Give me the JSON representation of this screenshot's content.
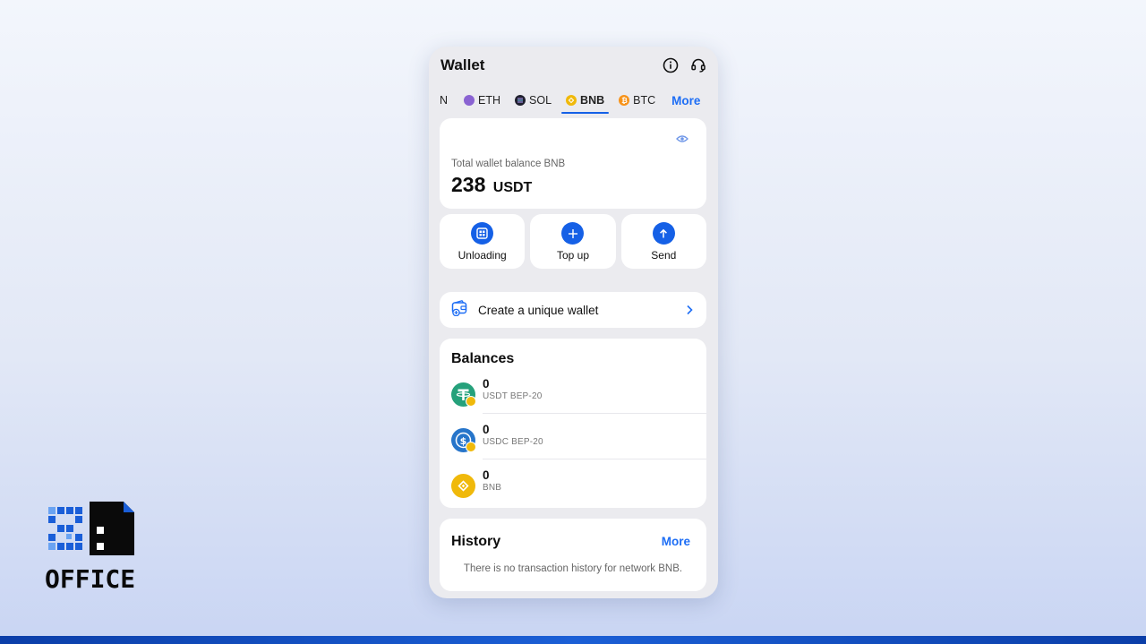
{
  "header": {
    "title": "Wallet",
    "info_icon": "info-icon",
    "support_icon": "headset-icon"
  },
  "tabs": [
    {
      "label": "N",
      "active": false
    },
    {
      "label": "ETH",
      "active": false,
      "color": "#8a63d2"
    },
    {
      "label": "SOL",
      "active": false,
      "color": "#1f1f2e"
    },
    {
      "label": "BNB",
      "active": true,
      "color": "#f0b90b"
    },
    {
      "label": "BTC",
      "active": false,
      "color": "#f7931a"
    }
  ],
  "tabs_more": "More",
  "balance": {
    "label": "Total wallet balance BNB",
    "amount": "238",
    "unit": "USDT",
    "eye_icon": "eye-icon"
  },
  "actions": [
    {
      "label": "Unloading",
      "icon": "wallet-grid-icon"
    },
    {
      "label": "Top up",
      "icon": "plus-icon"
    },
    {
      "label": "Send",
      "icon": "arrow-up-icon"
    }
  ],
  "create_wallet": {
    "label": "Create a unique wallet",
    "icon": "wallet-add-icon"
  },
  "balances": {
    "title": "Balances",
    "items": [
      {
        "amount": "0",
        "name": "USDT BEP-20",
        "color": "#26a17b"
      },
      {
        "amount": "0",
        "name": "USDC BEP-20",
        "color": "#2775ca"
      },
      {
        "amount": "0",
        "name": "BNB",
        "color": "#f0b90b"
      }
    ]
  },
  "history": {
    "title": "History",
    "more": "More",
    "empty": "There is no transaction history for network BNB."
  },
  "logo": {
    "text": "OFFICE"
  },
  "colors": {
    "accent": "#1560e6",
    "link": "#1e6ef5"
  }
}
